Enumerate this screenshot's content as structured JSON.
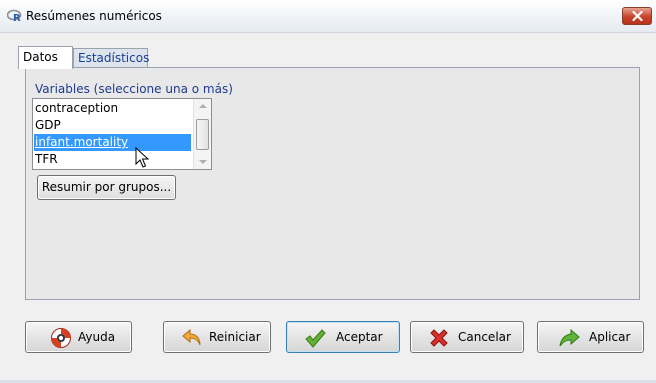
{
  "window": {
    "title": "Resúmenes numéricos"
  },
  "tabs": [
    {
      "label": "Datos",
      "active": true
    },
    {
      "label": "Estadísticos",
      "active": false
    }
  ],
  "variables": {
    "label": "Variables (seleccione una o más)",
    "items": [
      "contraception",
      "GDP",
      "infant.mortality",
      "TFR"
    ],
    "selected": "infant.mortality"
  },
  "group_button": {
    "label": "Resumir por grupos..."
  },
  "buttons": {
    "help": {
      "label": "Ayuda",
      "icon": "lifebuoy-icon"
    },
    "reset": {
      "label": "Reiniciar",
      "icon": "undo-arrow-icon"
    },
    "ok": {
      "label": "Aceptar",
      "icon": "checkmark-icon"
    },
    "cancel": {
      "label": "Cancelar",
      "icon": "red-x-icon"
    },
    "apply": {
      "label": "Aplicar",
      "icon": "green-arrow-icon"
    }
  },
  "colors": {
    "selection": "#3399ff",
    "link_text": "#1f3a8f",
    "close_button": "#c8412b"
  }
}
